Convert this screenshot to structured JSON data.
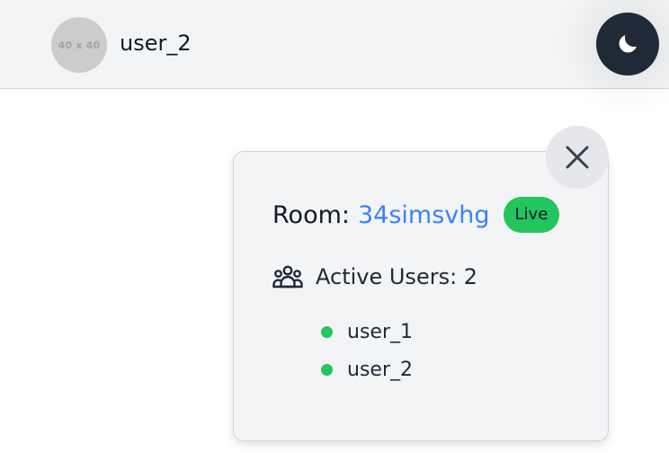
{
  "header": {
    "avatar_placeholder": "40 x 40",
    "username": "user_2",
    "theme_icon": "moon-icon"
  },
  "room_panel": {
    "close_icon": "close-icon",
    "room_label": "Room:",
    "room_id": "34simsvhg",
    "status_badge": "Live",
    "users_icon": "users-group-icon",
    "active_users_text": "Active Users: 2",
    "users": [
      {
        "name": "user_1",
        "status": "online"
      },
      {
        "name": "user_2",
        "status": "online"
      }
    ]
  },
  "colors": {
    "accent_blue": "#3b82f6",
    "online_green": "#22c55e",
    "dark_button": "#1f2937",
    "panel_bg": "#f3f4f6"
  }
}
